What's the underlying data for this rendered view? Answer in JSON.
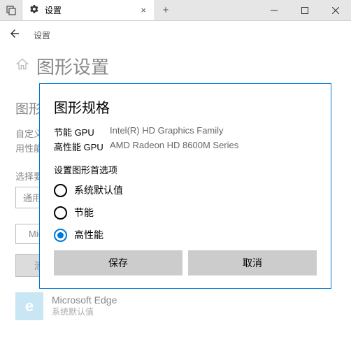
{
  "titlebar": {
    "tab_label": "设置",
    "close": "×",
    "plus": "+"
  },
  "nav": {
    "title": "设置"
  },
  "page": {
    "title": "图形设置",
    "section": "图形",
    "body1": "自定义",
    "body2": "用性能",
    "select_label": "选择要",
    "dropdown_value": "通用",
    "browse": "Micr",
    "add": "添"
  },
  "app": {
    "name": "Microsoft Edge",
    "sub": "系统默认值",
    "icon_letter": "e"
  },
  "modal": {
    "title": "图形规格",
    "gpu1_label": "节能 GPU",
    "gpu1_value": "Intel(R) HD Graphics Family",
    "gpu2_label": "高性能 GPU",
    "gpu2_value": "AMD Radeon HD 8600M Series",
    "pref_heading": "设置图形首选项",
    "opt1": "系统默认值",
    "opt2": "节能",
    "opt3": "高性能",
    "save": "保存",
    "cancel": "取消"
  }
}
